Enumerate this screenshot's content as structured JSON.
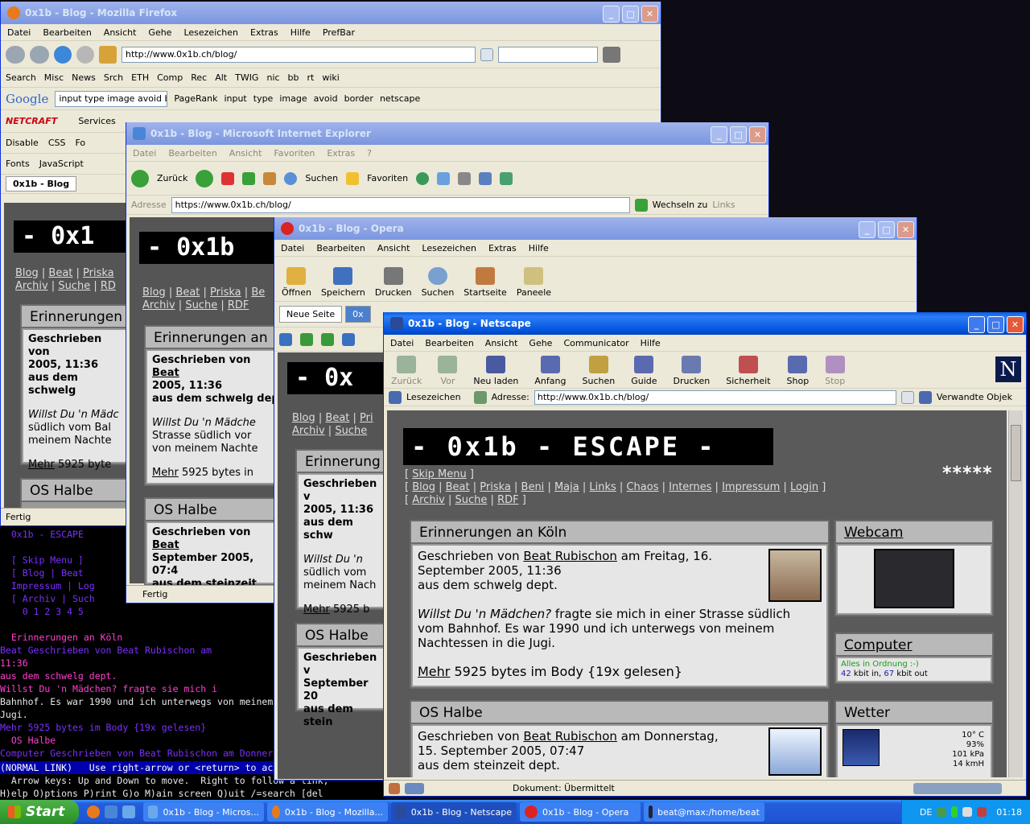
{
  "firefox": {
    "title": "0x1b - Blog - Mozilla Firefox",
    "menu": [
      "Datei",
      "Bearbeiten",
      "Ansicht",
      "Gehe",
      "Lesezeichen",
      "Extras",
      "Hilfe",
      "PrefBar"
    ],
    "url": "http://www.0x1b.ch/blog/",
    "bookmarks": [
      "Search",
      "Misc",
      "News",
      "Srch",
      "ETH",
      "Comp",
      "Rec",
      "Alt",
      "TWIG",
      "nic",
      "bb",
      "rt",
      "wiki"
    ],
    "google_query": "input type image avoid b",
    "google_items": [
      "PageRank",
      "input",
      "type",
      "image",
      "avoid",
      "border",
      "netscape"
    ],
    "netcraft_label": "Services",
    "dev_items": [
      "Disable",
      "CSS",
      "Fo"
    ],
    "prefs": [
      "Fonts",
      "JavaScript"
    ],
    "tab": "0x1b - Blog",
    "status": "Fertig",
    "logo": "- 0x1",
    "nav": [
      [
        "Blog",
        "Beat",
        "Priska"
      ],
      [
        "Archiv",
        "Suche",
        "RD"
      ]
    ],
    "post1_title": "Erinnerungen",
    "post1_meta": "Geschrieben von",
    "post1_meta2": "2005, 11:36",
    "post1_meta3": "aus dem schwelg",
    "post1_text1": "Willst Du 'n Mädc",
    "post1_text2": "südlich vom Bal",
    "post1_text3": "meinem Nachte",
    "more": "Mehr",
    "more_rest": "5925 byte",
    "post2_title": "OS Halbe"
  },
  "ie": {
    "title": "0x1b - Blog - Microsoft Internet Explorer",
    "menu": [
      "Datei",
      "Bearbeiten",
      "Ansicht",
      "Favoriten",
      "Extras",
      "?"
    ],
    "back": "Zurück",
    "search": "Suchen",
    "favorites": "Favoriten",
    "addr_label": "Adresse",
    "url": "https://www.0x1b.ch/blog/",
    "go": "Wechseln zu",
    "links": "Links",
    "status": "Fertig",
    "logo": "- 0x1b",
    "nav": [
      [
        "Blog",
        "Beat",
        "Priska",
        "Be"
      ],
      [
        "Archiv",
        "Suche",
        "RDF"
      ]
    ],
    "post1_title": "Erinnerungen an",
    "post1_meta": "Geschrieben von",
    "post1_author": "Beat",
    "post1_meta2": "2005, 11:36",
    "post1_meta3": "aus dem schwelg dep",
    "post1_text1": "Willst Du 'n Mädche",
    "post1_text2": "Strasse südlich vor",
    "post1_text3": "von meinem Nachte",
    "more": "Mehr",
    "more_rest": "5925 bytes in",
    "post2_title": "OS Halbe",
    "post2_meta": "Geschrieben von",
    "post2_author": "Beat",
    "post2_meta2": "September 2005, 07:4",
    "post2_meta3": "aus dem steinzeit dep"
  },
  "opera": {
    "title": "0x1b - Blog - Opera",
    "menu": [
      "Datei",
      "Bearbeiten",
      "Ansicht",
      "Lesezeichen",
      "Extras",
      "Hilfe"
    ],
    "tools": [
      "Öffnen",
      "Speichern",
      "Drucken",
      "Suchen",
      "Startseite",
      "Paneele"
    ],
    "tab_new": "Neue Seite",
    "tab2": "0x",
    "logo": "- 0x",
    "nav": [
      [
        "Blog",
        "Beat",
        "Pri"
      ],
      [
        "Archiv",
        "Suche"
      ]
    ],
    "post1_title": "Erinnerung",
    "post1_meta": "Geschrieben v",
    "post1_meta2": "2005, 11:36",
    "post1_meta3": "aus dem schw",
    "post1_text1": "Willst Du 'n",
    "post1_text2": "südlich vom",
    "post1_text3": "meinem Nach",
    "more": "Mehr",
    "more_rest": "5925 b",
    "post2_title": "OS Halbe",
    "post2_meta": "Geschrieben v",
    "post2_meta2": "September 20",
    "post2_meta3": "aus dem stein"
  },
  "netscape": {
    "title": "0x1b - Blog - Netscape",
    "menu": [
      "Datei",
      "Bearbeiten",
      "Ansicht",
      "Gehe",
      "Communicator",
      "Hilfe"
    ],
    "tools": [
      "Zurück",
      "Vor",
      "Neu laden",
      "Anfang",
      "Suchen",
      "Guide",
      "Drucken",
      "Sicherheit",
      "Shop",
      "Stop"
    ],
    "bookmarks_label": "Lesezeichen",
    "addr_label": "Adresse:",
    "url": "http://www.0x1b.ch/blog/",
    "related": "Verwandte Objek",
    "status": "Dokument: Übermittelt"
  },
  "page": {
    "logo": "- 0x1b - ESCAPE -",
    "stars": "*****",
    "skip": "Skip Menu",
    "nav1": [
      "Blog",
      "Beat",
      "Priska",
      "Beni",
      "Maja",
      "Links",
      "Chaos",
      "Internes",
      "Impressum",
      "Login"
    ],
    "nav2": [
      "Archiv",
      "Suche",
      "RDF"
    ],
    "post1_title": "Erinnerungen an Köln",
    "post1_by": "Geschrieben von",
    "post1_author": "Beat Rubischon",
    "post1_date1": "am Freitag, 16.",
    "post1_date2": "September 2005, 11:36",
    "post1_dept": "aus dem schwelg dept.",
    "post1_q": "Willst Du 'n Mädchen?",
    "post1_t1": "fragte sie mich in einer Strasse südlich",
    "post1_t2": "vom Bahnhof. Es war 1990 und ich unterwegs von meinem",
    "post1_t3": "Nachtessen in die Jugi.",
    "more": "Mehr",
    "more_rest": "5925 bytes im Body {19x gelesen}",
    "post2_title": "OS Halbe",
    "post2_by": "Geschrieben von",
    "post2_author": "Beat Rubischon",
    "post2_date1": "am Donnerstag,",
    "post2_date2": "15. September 2005, 07:47",
    "post2_dept": "aus dem steinzeit dept.",
    "webcam": "Webcam",
    "computer": "Computer",
    "comp_status": "Alles in Ordnung :-)",
    "comp_in_num": "42",
    "comp_in": "kbit in,",
    "comp_out_num": "67",
    "comp_out": "kbit out",
    "wetter": "Wetter",
    "w_temp": "10° C",
    "w_hum": "93%",
    "w_press": "101 kPa",
    "w_wind": "14 kmH"
  },
  "lynx": {
    "lines": [
      "  0x1b - ESCAPE",
      "",
      "  [ Skip Menu ]",
      "  [ Blog | Beat",
      "  Impressum | Log",
      "  [ Archiv | Such",
      "    0 1 2 3 4 5",
      "",
      "  Erinnerungen an Köln",
      "Beat Geschrieben von Beat Rubischon am",
      "11:36",
      "aus dem schwelg dept.",
      "Willst Du 'n Mädchen? fragte sie mich i",
      "Bahnhof. Es war 1990 und ich unterwegs von meinem Nachte",
      "Jugi.",
      "Mehr 5925 bytes im Body {19x gelesen}",
      "  OS Halbe",
      "Computer Geschrieben von Beat Rubischon am Donnerstag, 1"
    ],
    "statusline": "(NORMAL LINK)   Use right-arrow or <return> to activate.",
    "help1": "  Arrow keys: Up and Down to move.  Right to follow a link;",
    "help2": "H)elp O)ptions P)rint G)o M)ain screen Q)uit /=search [del"
  },
  "taskbar": {
    "start": "Start",
    "tasks": [
      "0x1b - Blog - Micros...",
      "0x1b - Blog - Mozilla...",
      "0x1b - Blog - Netscape",
      "0x1b - Blog - Opera",
      "beat@max:/home/beat"
    ],
    "lang": "DE",
    "time": "01:18"
  },
  "colors": {
    "xp_blue": "#0a5ee6",
    "lynx_link": "#7b2fff",
    "lynx_current": "#0000aa",
    "page_gray": "#9a9a9a"
  }
}
